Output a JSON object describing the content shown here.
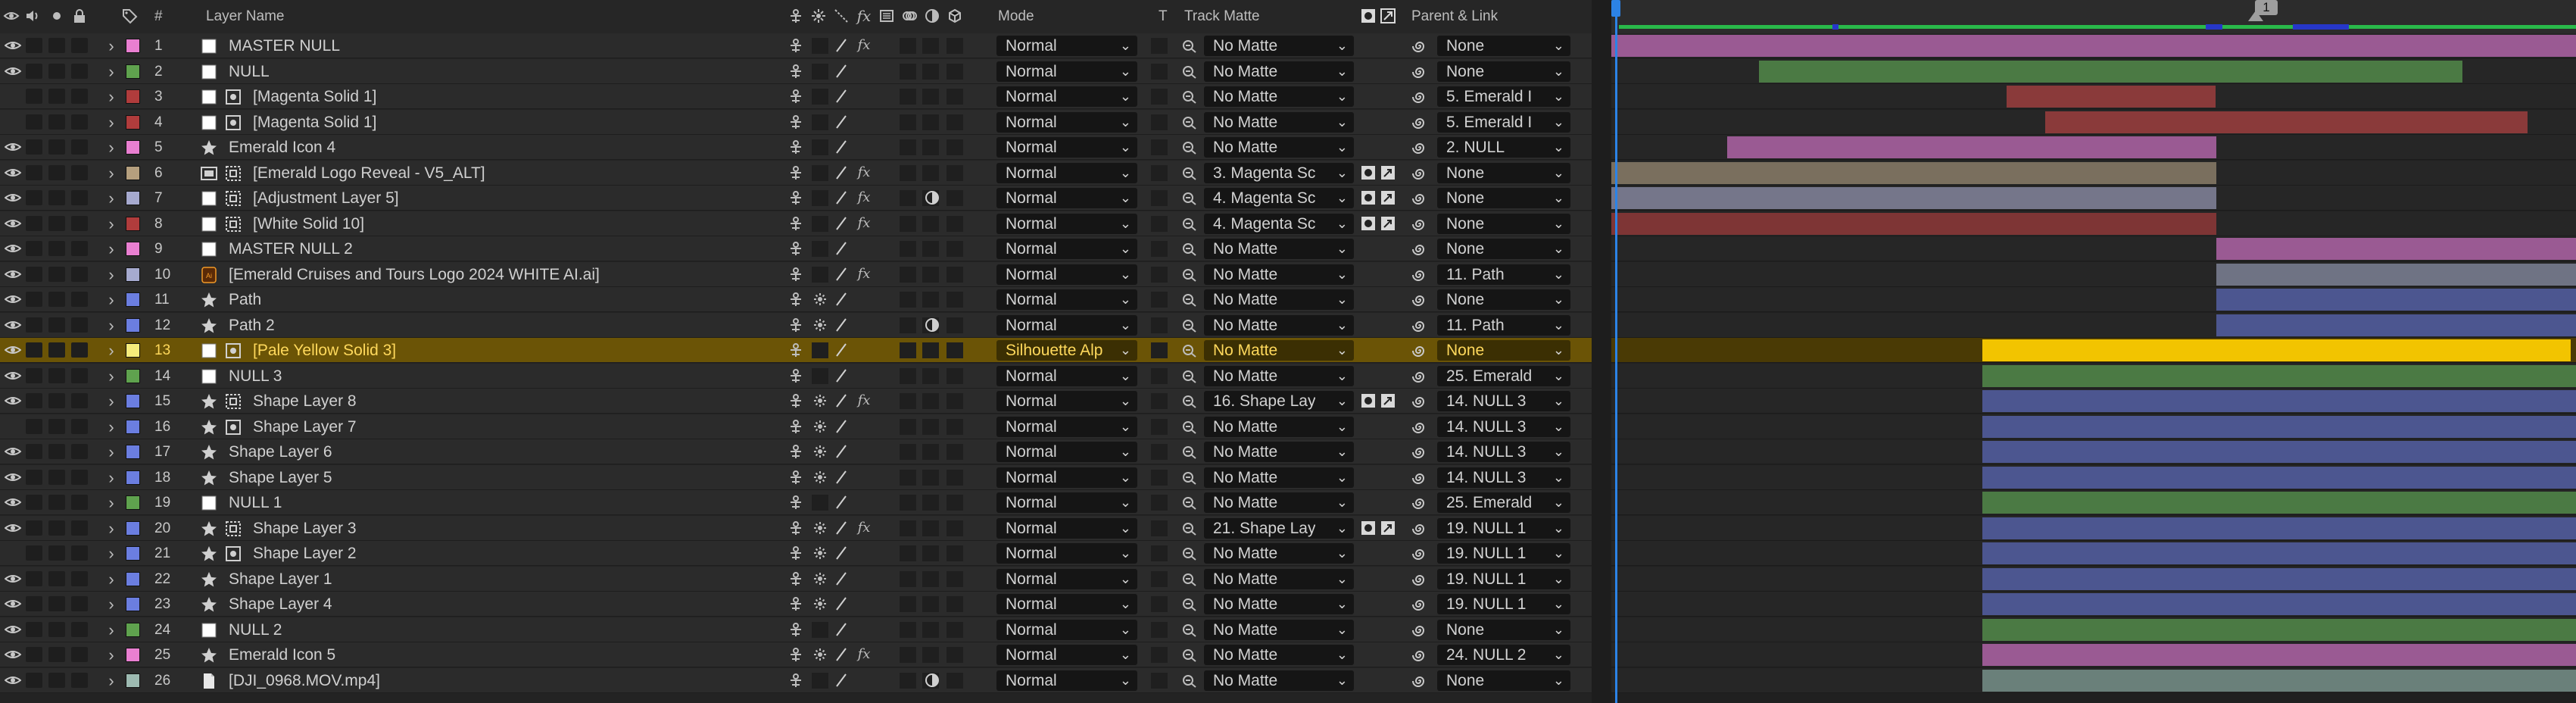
{
  "header": {
    "col_num": "#",
    "col_layer_name": "Layer Name",
    "col_mode": "Mode",
    "col_t": "T",
    "col_track_matte": "Track Matte",
    "col_parent_link": "Parent & Link",
    "header_icons": [
      "eye-icon",
      "speaker-icon",
      "solo-icon",
      "lock-icon",
      "tag-icon",
      "shy-icon",
      "collapse-icon",
      "quality-icon",
      "fx-icon",
      "frame-blend-icon",
      "motion-blur-icon",
      "adjustment-icon",
      "3d-icon"
    ]
  },
  "timeline": {
    "marker_label": "1",
    "colors": {
      "workarea": "#29b94a",
      "cache": "#2637c9",
      "playhead": "#2c83e6"
    }
  },
  "layers": [
    {
      "num": "1",
      "name": "MASTER NULL",
      "label_color": "#e97fd1",
      "type": "null",
      "eye": true,
      "switch_fx": true,
      "mode": "Normal",
      "matte": "No Matte",
      "parent": "None",
      "bar_color": "#9a5a93",
      "bar_start": 0.0,
      "bar_end": 1.0
    },
    {
      "num": "2",
      "name": "NULL",
      "label_color": "#5fa24e",
      "type": "null",
      "eye": true,
      "mode": "Normal",
      "matte": "No Matte",
      "parent": "None",
      "bar_color": "#4b7a44",
      "bar_start": 0.153,
      "bar_end": 0.882
    },
    {
      "num": "3",
      "name": "[Magenta Solid 1]",
      "label_color": "#b03c3c",
      "type": "solid",
      "eye": false,
      "mode": "Normal",
      "matte": "No Matte",
      "parent": "5. Emerald I",
      "bar_color": "#8a3a3a",
      "bar_start": 0.41,
      "bar_end": 0.627
    },
    {
      "num": "4",
      "name": "[Magenta Solid 1]",
      "label_color": "#b03c3c",
      "type": "solid",
      "eye": false,
      "mode": "Normal",
      "matte": "No Matte",
      "parent": "5. Emerald I",
      "bar_color": "#8a3a3a",
      "bar_start": 0.45,
      "bar_end": 0.95
    },
    {
      "num": "5",
      "name": "Emerald Icon 4",
      "label_color": "#e97fd1",
      "type": "shape",
      "eye": true,
      "mode": "Normal",
      "matte": "No Matte",
      "parent": "2. NULL",
      "bar_color": "#9a5a93",
      "bar_start": 0.12,
      "bar_end": 0.627
    },
    {
      "num": "6",
      "name": "[Emerald Logo Reveal - V5_ALT]",
      "label_color": "#b59f7e",
      "type": "precomp",
      "eye": true,
      "switch_fx": true,
      "switch_cam": true,
      "mode": "Normal",
      "matte": "3. Magenta Sc",
      "matte_icons": true,
      "parent": "None",
      "bar_color": "#7a6f5e",
      "bar_start": 0.0,
      "bar_end": 0.627
    },
    {
      "num": "7",
      "name": "[Adjustment Layer 5]",
      "label_color": "#a6aacf",
      "type": "comp",
      "eye": true,
      "switch_fx": true,
      "switch_adj": true,
      "mode": "Normal",
      "matte": "4. Magenta Sc",
      "matte_icons": true,
      "parent": "None",
      "bar_color": "#75768a",
      "bar_start": 0.0,
      "bar_end": 0.627
    },
    {
      "num": "8",
      "name": "[White Solid 10]",
      "label_color": "#b03c3c",
      "type": "comp",
      "eye": true,
      "switch_fx": true,
      "mode": "Normal",
      "matte": "4. Magenta Sc",
      "matte_icons": true,
      "parent": "None",
      "bar_color": "#7e3535",
      "bar_start": 0.0,
      "bar_end": 0.627
    },
    {
      "num": "9",
      "name": "MASTER NULL 2",
      "label_color": "#e97fd1",
      "type": "null",
      "eye": true,
      "mode": "Normal",
      "matte": "No Matte",
      "parent": "None",
      "bar_color": "#9a5a93",
      "bar_start": 0.627,
      "bar_end": 1.0
    },
    {
      "num": "10",
      "name": "[Emerald Cruises and Tours Logo 2024 WHITE AI.ai]",
      "label_color": "#a6aacf",
      "type": "ai",
      "eye": true,
      "switch_fx": true,
      "mode": "Normal",
      "matte": "No Matte",
      "parent": "11. Path",
      "bar_color": "#6f7384",
      "bar_start": 0.627,
      "bar_end": 1.0
    },
    {
      "num": "11",
      "name": "Path",
      "label_color": "#6b7ee0",
      "type": "shape",
      "eye": true,
      "switch_sun": true,
      "mode": "Normal",
      "matte": "No Matte",
      "parent": "None",
      "bar_color": "#4c5690",
      "bar_start": 0.627,
      "bar_end": 1.0
    },
    {
      "num": "12",
      "name": "Path 2",
      "label_color": "#6b7ee0",
      "type": "shape",
      "eye": true,
      "switch_sun": true,
      "switch_adj": true,
      "mode": "Normal",
      "matte": "No Matte",
      "parent": "11. Path",
      "bar_color": "#4c5690",
      "bar_start": 0.627,
      "bar_end": 1.0
    },
    {
      "num": "13",
      "name": "[Pale Yellow Solid 3]",
      "label_color": "#f6ec7b",
      "type": "solid",
      "eye": true,
      "selected": true,
      "mode": "Silhouette Alp",
      "matte": "No Matte",
      "parent": "None",
      "bar_color": "#f2c400",
      "bar_start": 0.385,
      "bar_end": 0.995
    },
    {
      "num": "14",
      "name": "NULL 3",
      "label_color": "#5fa24e",
      "type": "null",
      "eye": true,
      "mode": "Normal",
      "matte": "No Matte",
      "parent": "25. Emerald",
      "bar_color": "#4b7a44",
      "bar_start": 0.385,
      "bar_end": 1.0
    },
    {
      "num": "15",
      "name": "Shape Layer 8",
      "label_color": "#6b7ee0",
      "type": "shape_comp",
      "eye": true,
      "switch_sun": true,
      "switch_fx": true,
      "mode": "Normal",
      "matte": "16. Shape Lay",
      "matte_icons": true,
      "parent": "14. NULL 3",
      "bar_color": "#4c5690",
      "bar_start": 0.385,
      "bar_end": 1.0
    },
    {
      "num": "16",
      "name": "Shape Layer 7",
      "label_color": "#6b7ee0",
      "type": "shape_solid",
      "eye": false,
      "switch_sun": true,
      "mode": "Normal",
      "matte": "No Matte",
      "parent": "14. NULL 3",
      "bar_color": "#4c5690",
      "bar_start": 0.385,
      "bar_end": 1.0
    },
    {
      "num": "17",
      "name": "Shape Layer 6",
      "label_color": "#6b7ee0",
      "type": "shape",
      "eye": true,
      "switch_sun": true,
      "mode": "Normal",
      "matte": "No Matte",
      "parent": "14. NULL 3",
      "bar_color": "#4c5690",
      "bar_start": 0.385,
      "bar_end": 1.0
    },
    {
      "num": "18",
      "name": "Shape Layer 5",
      "label_color": "#6b7ee0",
      "type": "shape",
      "eye": true,
      "switch_sun": true,
      "mode": "Normal",
      "matte": "No Matte",
      "parent": "14. NULL 3",
      "bar_color": "#4c5690",
      "bar_start": 0.385,
      "bar_end": 1.0
    },
    {
      "num": "19",
      "name": "NULL 1",
      "label_color": "#5fa24e",
      "type": "null",
      "eye": true,
      "mode": "Normal",
      "matte": "No Matte",
      "parent": "25. Emerald",
      "bar_color": "#4b7a44",
      "bar_start": 0.385,
      "bar_end": 1.0
    },
    {
      "num": "20",
      "name": "Shape Layer 3",
      "label_color": "#6b7ee0",
      "type": "shape_comp",
      "eye": true,
      "switch_sun": true,
      "switch_fx": true,
      "mode": "Normal",
      "matte": "21. Shape Lay",
      "matte_icons": true,
      "parent": "19. NULL 1",
      "bar_color": "#4c5690",
      "bar_start": 0.385,
      "bar_end": 1.0
    },
    {
      "num": "21",
      "name": "Shape Layer 2",
      "label_color": "#6b7ee0",
      "type": "shape_solid",
      "eye": false,
      "switch_sun": true,
      "mode": "Normal",
      "matte": "No Matte",
      "parent": "19. NULL 1",
      "bar_color": "#4c5690",
      "bar_start": 0.385,
      "bar_end": 1.0
    },
    {
      "num": "22",
      "name": "Shape Layer 1",
      "label_color": "#6b7ee0",
      "type": "shape",
      "eye": true,
      "switch_sun": true,
      "mode": "Normal",
      "matte": "No Matte",
      "parent": "19. NULL 1",
      "bar_color": "#4c5690",
      "bar_start": 0.385,
      "bar_end": 1.0
    },
    {
      "num": "23",
      "name": "Shape Layer 4",
      "label_color": "#6b7ee0",
      "type": "shape",
      "eye": true,
      "switch_sun": true,
      "mode": "Normal",
      "matte": "No Matte",
      "parent": "19. NULL 1",
      "bar_color": "#4c5690",
      "bar_start": 0.385,
      "bar_end": 1.0
    },
    {
      "num": "24",
      "name": "NULL 2",
      "label_color": "#5fa24e",
      "type": "null",
      "eye": true,
      "mode": "Normal",
      "matte": "No Matte",
      "parent": "None",
      "bar_color": "#4b7a44",
      "bar_start": 0.385,
      "bar_end": 1.0
    },
    {
      "num": "25",
      "name": "Emerald Icon 5",
      "label_color": "#e97fd1",
      "type": "shape",
      "eye": true,
      "switch_sun": true,
      "switch_fx": true,
      "mode": "Normal",
      "matte": "No Matte",
      "parent": "24. NULL 2",
      "bar_color": "#9a5a93",
      "bar_start": 0.385,
      "bar_end": 1.0
    },
    {
      "num": "26",
      "name": "[DJI_0968.MOV.mp4]",
      "label_color": "#9dbab1",
      "type": "footage",
      "eye": true,
      "switch_adj": true,
      "mode": "Normal",
      "matte": "No Matte",
      "parent": "None",
      "bar_color": "#6a807a",
      "bar_start": 0.385,
      "bar_end": 1.0
    }
  ]
}
